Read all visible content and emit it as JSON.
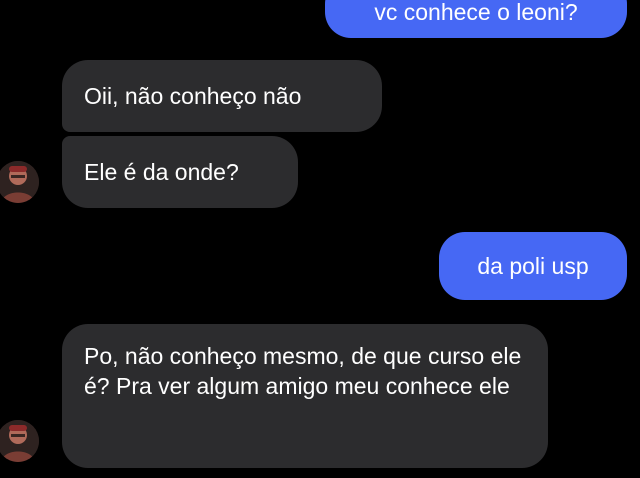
{
  "messages": [
    {
      "direction": "outgoing",
      "text": "vc conhece o leoni?"
    },
    {
      "direction": "incoming",
      "text": "Oii, não conheço não"
    },
    {
      "direction": "incoming",
      "text": "Ele é da onde?"
    },
    {
      "direction": "outgoing",
      "text": "da poli usp"
    },
    {
      "direction": "incoming",
      "text": "Po, não conheço mesmo, de que curso ele é? Pra ver algum amigo meu conhece ele"
    }
  ],
  "colors": {
    "background": "#000000",
    "outgoing_bubble": "#4668f4",
    "incoming_bubble": "#2c2c2e",
    "text": "#ffffff"
  },
  "icons": {
    "contact_avatar": "contact-photo"
  }
}
